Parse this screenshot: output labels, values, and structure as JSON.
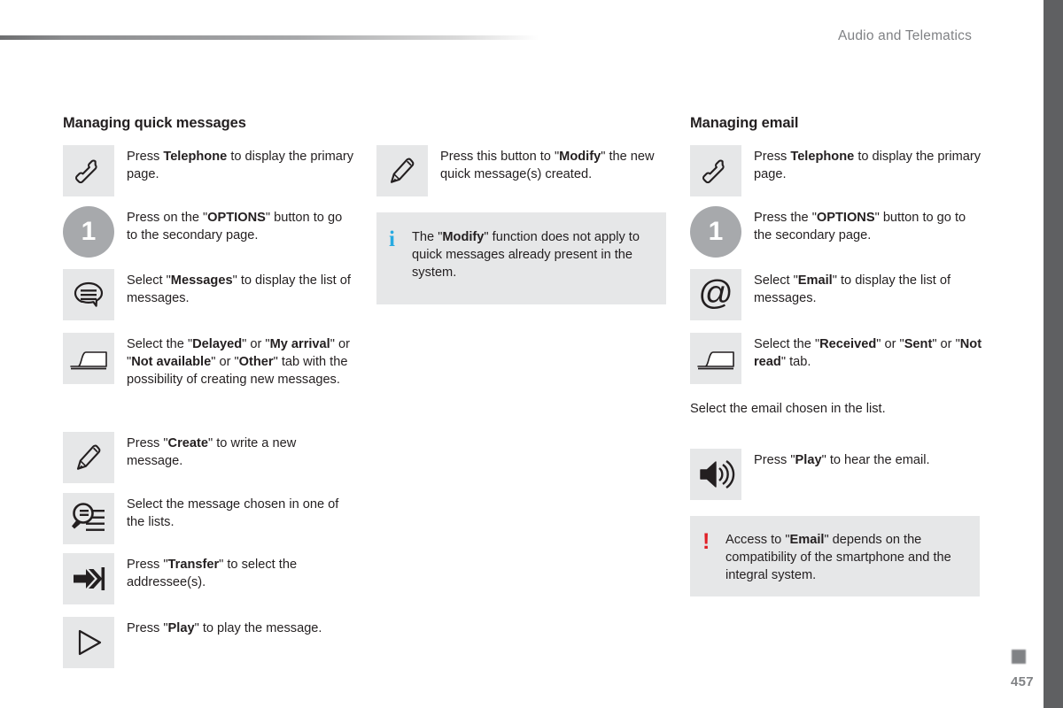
{
  "header": {
    "title": "Audio and Telematics"
  },
  "footer": {
    "page_number": "457"
  },
  "colors": {
    "icon_box_bg": "#e6e7e8",
    "step_circle_bg": "#a7a9ac",
    "info_mark": "#27aae1",
    "warning_mark": "#e01f26",
    "edge_bar": "#5f6062",
    "header_text": "#808285"
  },
  "left_column": {
    "title": "Managing quick messages",
    "steps": [
      {
        "icon": "telephone-handset-icon",
        "text_html": "Press <b>Telephone</b> to display the primary page."
      },
      {
        "icon": "step-number-1-icon",
        "number": "1",
        "text_html": "Press on the \"<b>OPTIONS</b>\" button to go to the secondary page."
      },
      {
        "icon": "message-bubble-icon",
        "text_html": "Select \"<b>Messages</b>\" to display the list of messages."
      },
      {
        "icon": "tab-icon",
        "text_html": "Select the \"<b>Delayed</b>\" or \"<b>My arrival</b>\" or \"<b>Not available</b>\" or \"<b>Other</b>\" tab with the possibility of creating new messages."
      },
      {
        "icon": "pencil-icon",
        "text_html": "Press \"<b>Create</b>\" to write a new message."
      },
      {
        "icon": "search-list-icon",
        "text_html": "Select the message chosen in one of the lists."
      },
      {
        "icon": "transfer-arrow-icon",
        "text_html": "Press \"<b>Transfer</b>\" to select the addressee(s)."
      },
      {
        "icon": "play-triangle-icon",
        "text_html": "Press \"<b>Play</b>\" to play the message."
      }
    ]
  },
  "middle_column": {
    "steps": [
      {
        "icon": "pencil-icon",
        "text_html": "Press this button to \"<b>Modify</b>\" the new quick message(s) created."
      }
    ],
    "note": {
      "type": "info",
      "mark": "i",
      "text_html": "The \"<b>Modify</b>\" function does not apply to quick messages already present in the system."
    }
  },
  "right_column": {
    "title": "Managing email",
    "steps": [
      {
        "icon": "telephone-handset-icon",
        "text_html": "Press <b>Telephone</b> to display the primary page."
      },
      {
        "icon": "step-number-1-icon",
        "number": "1",
        "text_html": "Press the \"<b>OPTIONS</b>\" button to go to the secondary page."
      },
      {
        "icon": "at-sign-icon",
        "text_html": "Select \"<b>Email</b>\" to display the list of messages."
      },
      {
        "icon": "tab-icon",
        "text_html": "Select the \"<b>Received</b>\" or \"<b>Sent</b>\" or \"<b>Not read</b>\" tab."
      }
    ],
    "standalone_text": "Select the email chosen in the list.",
    "play_step": {
      "icon": "speaker-icon",
      "text_html": "Press \"<b>Play</b>\" to hear the email."
    },
    "note": {
      "type": "warning",
      "mark": "!",
      "text_html": "Access to \"<b>Email</b>\" depends on the compatibility of the smartphone and the integral system."
    }
  }
}
